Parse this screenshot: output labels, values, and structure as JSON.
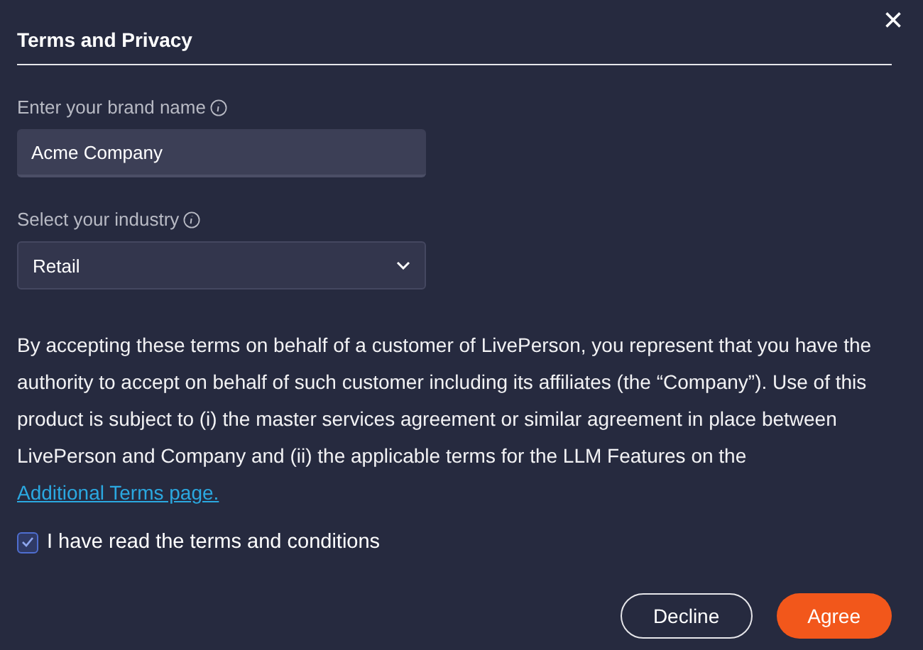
{
  "dialog": {
    "title": "Terms and Privacy",
    "close": "×"
  },
  "brand_field": {
    "label": "Enter your brand name",
    "value": "Acme Company"
  },
  "industry_select": {
    "label": "Select your industry",
    "value": "Retail"
  },
  "terms": {
    "text": "By accepting these terms on behalf of a customer of LivePerson, you represent that you have the authority to accept on behalf of such customer including its affiliates (the “Company”). Use of this product is subject to (i) the master services agreement or similar agreement in place between LivePerson and Company and (ii) the applicable terms for the LLM Features on the",
    "link": "Additional Terms page."
  },
  "agreement": {
    "label": "I have read the terms and conditions",
    "checked": true
  },
  "buttons": [
    {
      "label": "Decline",
      "kind": "secondary"
    },
    {
      "label": "Agree",
      "kind": "primary"
    }
  ]
}
